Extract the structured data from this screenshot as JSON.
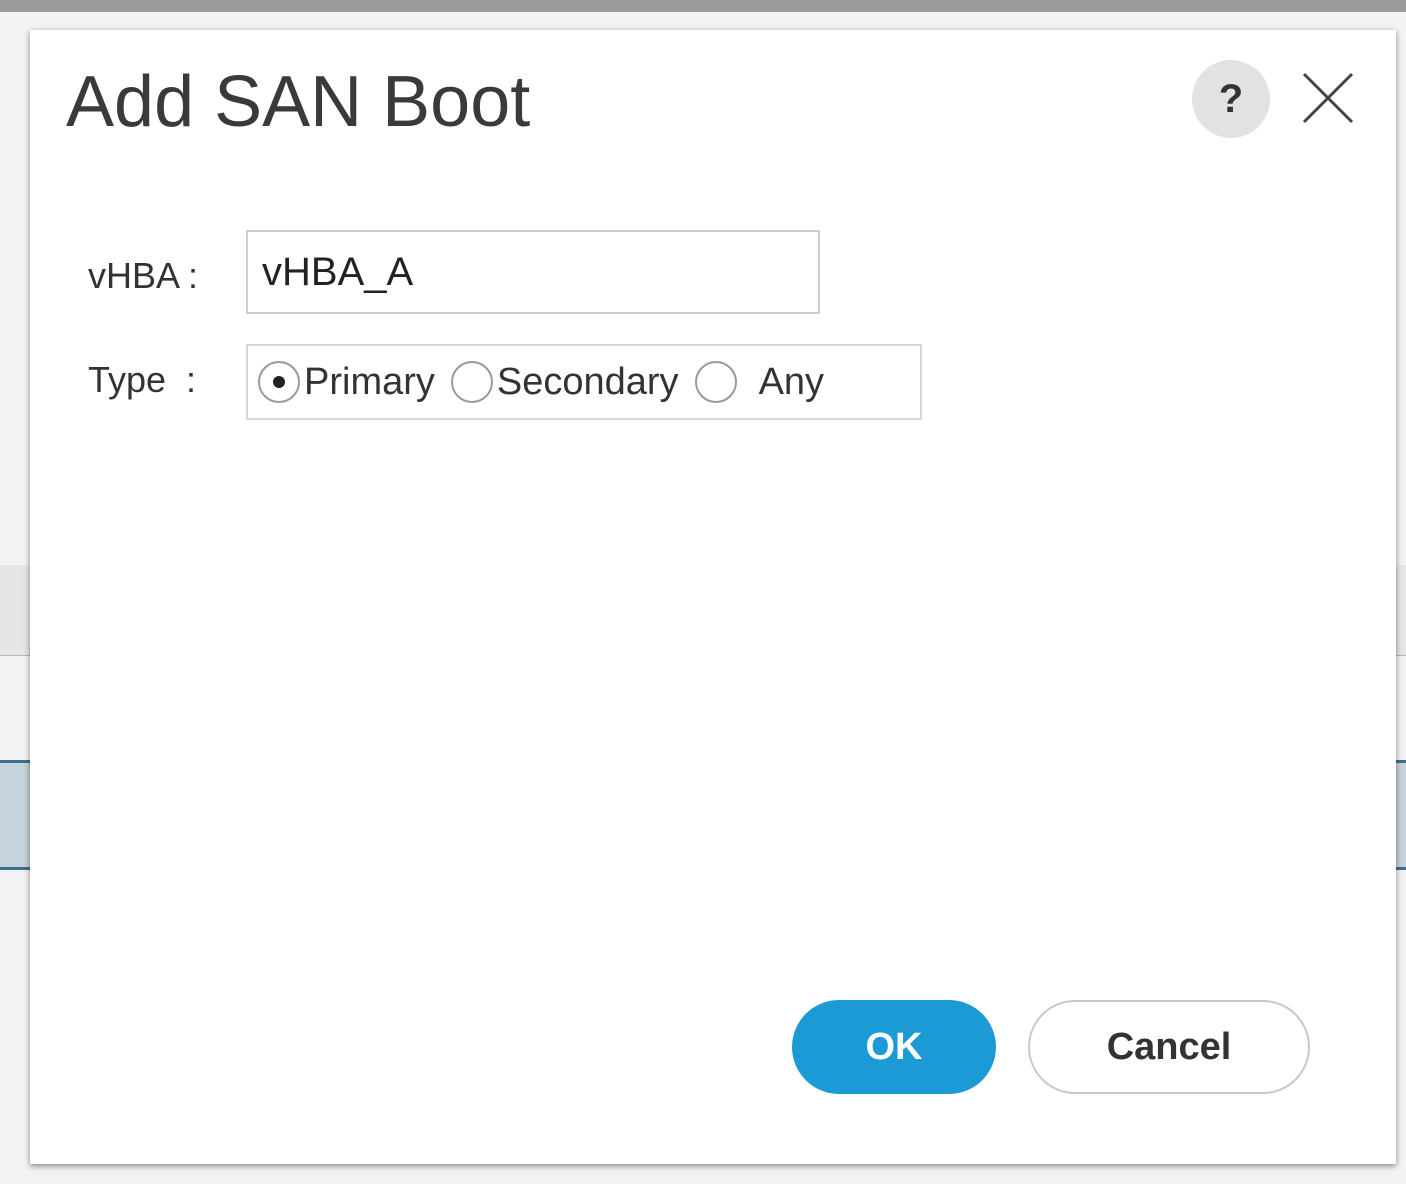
{
  "dialog": {
    "title": "Add SAN Boot",
    "help_label": "?"
  },
  "form": {
    "vhba_label": "vHBA :",
    "vhba_value": "vHBA_A",
    "type_label": "Type  :",
    "type_options": [
      {
        "label": "Primary",
        "selected": true
      },
      {
        "label": "Secondary",
        "selected": false
      },
      {
        "label": "Any",
        "selected": false
      }
    ]
  },
  "buttons": {
    "ok_label": "OK",
    "cancel_label": "Cancel"
  },
  "colors": {
    "accent": "#1b9ad6",
    "title_text": "#3a3a3a"
  }
}
